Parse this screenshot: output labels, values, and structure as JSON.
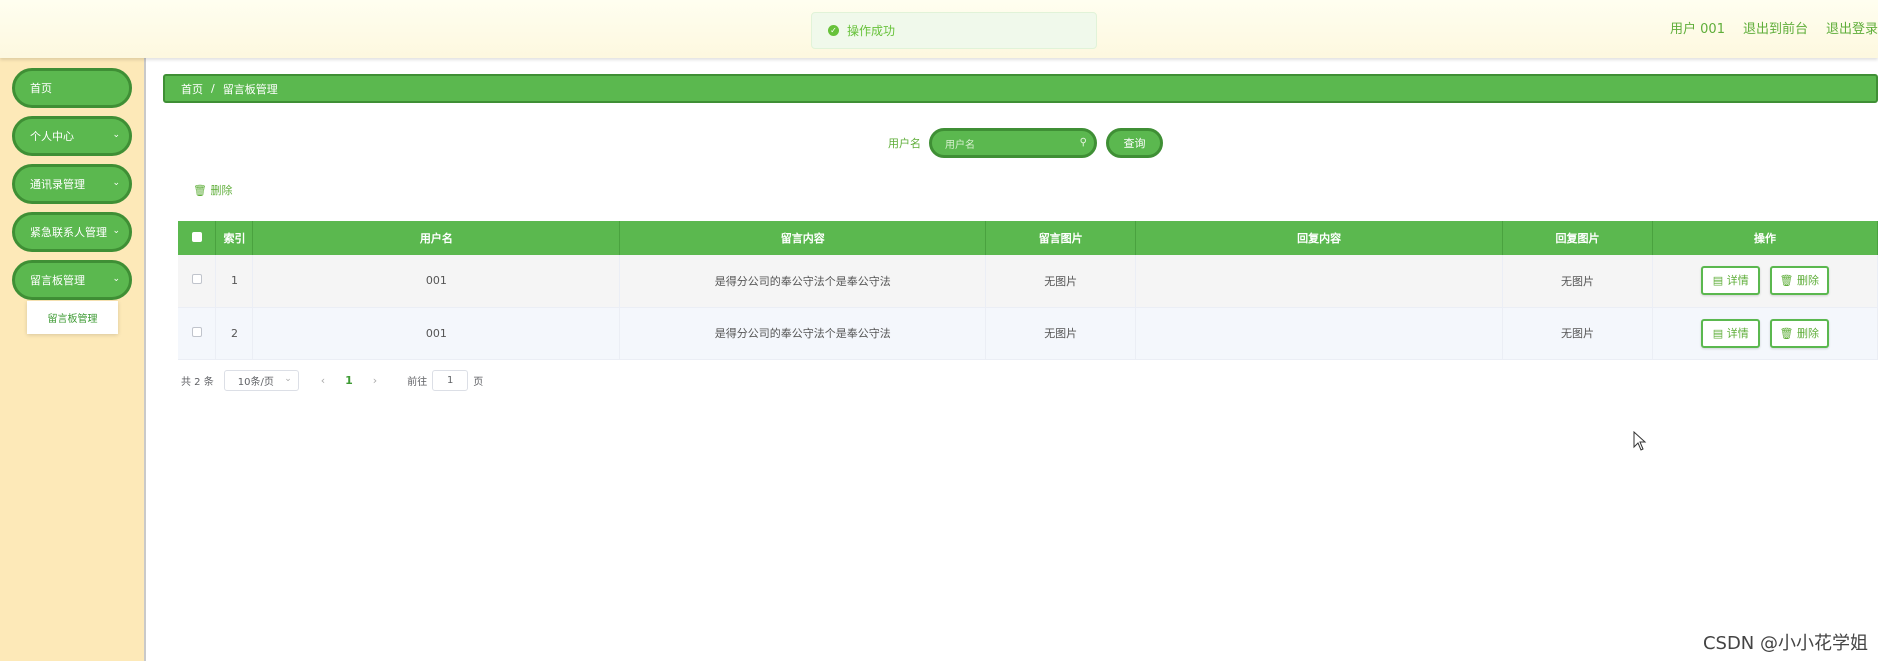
{
  "toast": {
    "text": "操作成功"
  },
  "header": {
    "user": "用户 001",
    "to_front": "退出到前台",
    "logout": "退出登录"
  },
  "sidebar": {
    "items": [
      {
        "label": "首页",
        "has_children": false
      },
      {
        "label": "个人中心",
        "has_children": true
      },
      {
        "label": "通讯录管理",
        "has_children": true
      },
      {
        "label": "紧急联系人管理",
        "has_children": true
      },
      {
        "label": "留言板管理",
        "has_children": true
      }
    ],
    "submenu": {
      "label": "留言板管理"
    }
  },
  "breadcrumb": {
    "home": "首页",
    "sep": "/",
    "current": "留言板管理"
  },
  "search": {
    "label": "用户名",
    "placeholder": "用户名",
    "button": "查询"
  },
  "toolbar": {
    "delete": "删除"
  },
  "table": {
    "columns": [
      "索引",
      "用户名",
      "留言内容",
      "留言图片",
      "回复内容",
      "回复图片",
      "操作"
    ],
    "rows": [
      {
        "index": "1",
        "username": "001",
        "content": "是得分公司的奉公守法个是奉公守法",
        "image": "无图片",
        "reply": "",
        "reply_image": "无图片"
      },
      {
        "index": "2",
        "username": "001",
        "content": "是得分公司的奉公守法个是奉公守法",
        "image": "无图片",
        "reply": "",
        "reply_image": "无图片"
      }
    ],
    "detail_label": "详情",
    "delete_label": "删除"
  },
  "pagination": {
    "total": "共 2 条",
    "page_size": "10条/页",
    "current": "1",
    "goto_prefix": "前往",
    "goto_value": "1",
    "goto_suffix": "页"
  },
  "watermark": "CSDN @小小花学姐"
}
